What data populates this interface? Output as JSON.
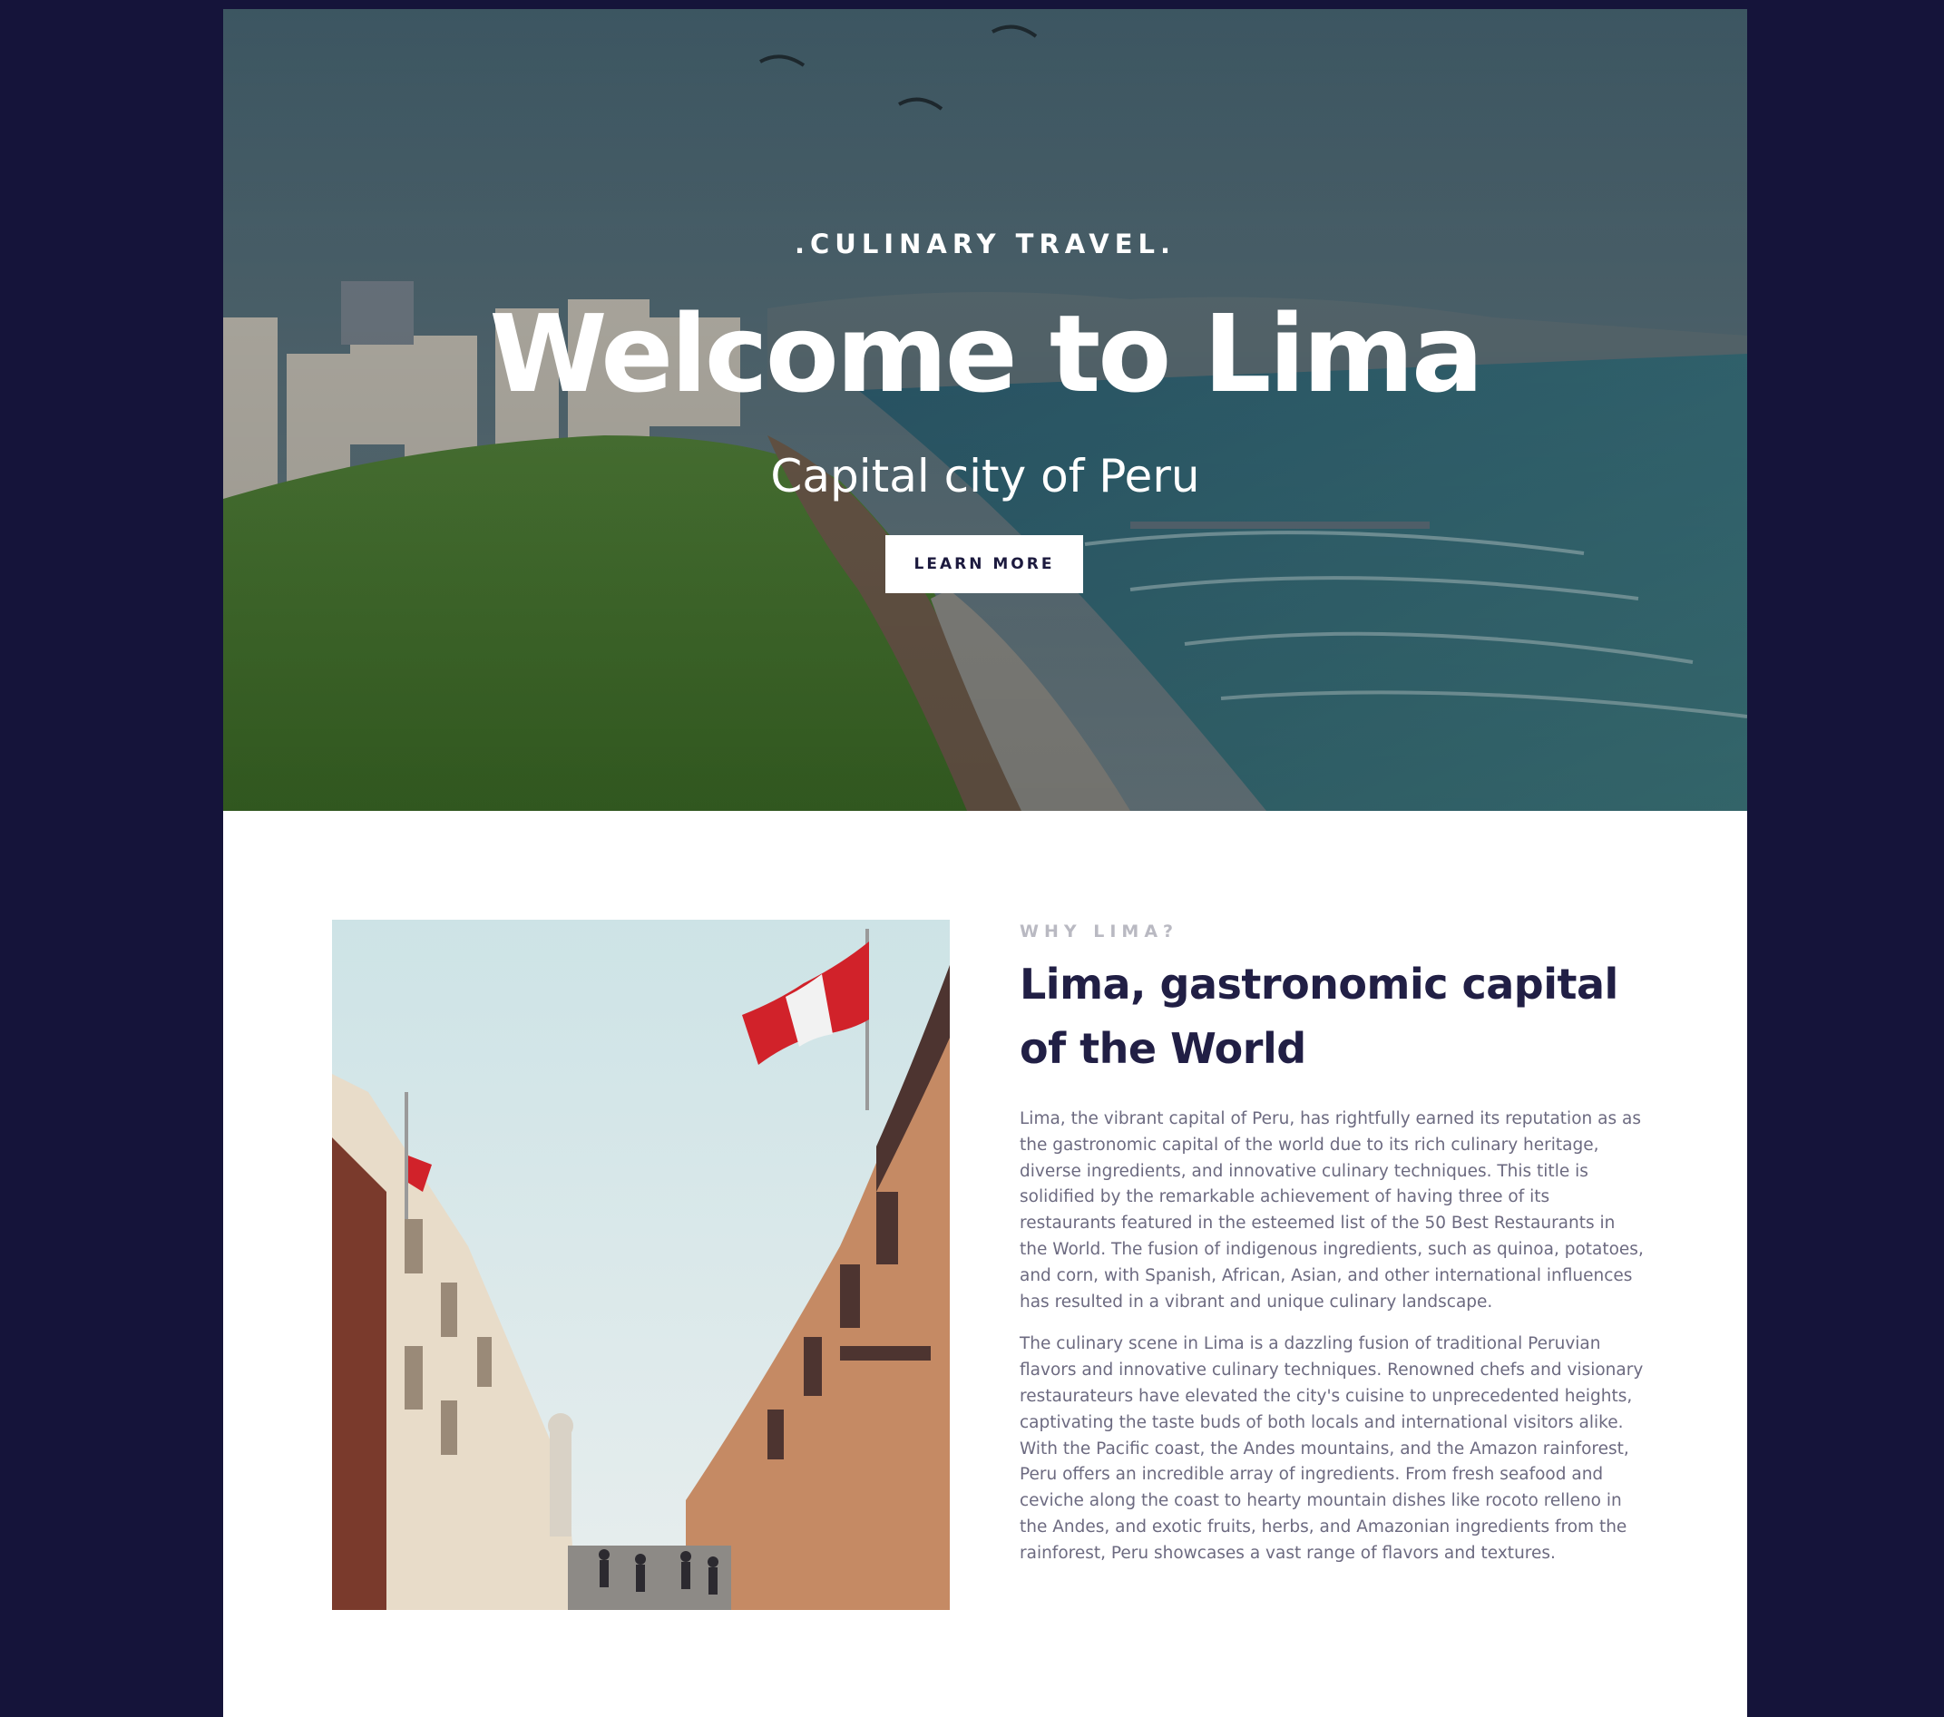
{
  "hero": {
    "eyebrow": ".CULINARY TRAVEL.",
    "title": "Welcome to Lima",
    "subtitle": "Capital city of Peru",
    "button_label": "LEARN MORE"
  },
  "about": {
    "eyebrow": "WHY LIMA?",
    "heading": "Lima, gastronomic capital of the World",
    "paragraphs": [
      "Lima, the vibrant capital of Peru, has rightfully earned its reputation as as the gastronomic capital of the world due to its rich culinary heritage, diverse ingredients, and innovative culinary techniques. This title is solidified by the remarkable achievement of having three of its restaurants featured in the esteemed list of the 50 Best Restaurants in the World. The fusion of indigenous ingredients, such as quinoa, potatoes, and corn, with Spanish, African, Asian, and other international influences has resulted in a vibrant and unique culinary landscape.",
      "The culinary scene in Lima is a dazzling fusion of traditional Peruvian flavors and innovative culinary techniques. Renowned chefs and visionary restaurateurs have elevated the city's cuisine to unprecedented heights, captivating the taste buds of both locals and international visitors alike. With the Pacific coast, the Andes mountains, and the Amazon rainforest, Peru offers an incredible array of ingredients. From fresh seafood and ceviche along the coast to hearty mountain dishes like rocoto relleno in the Andes, and exotic fruits, herbs, and Amazonian ingredients from the rainforest, Peru showcases a vast range of flavors and textures."
    ]
  },
  "colors": {
    "page_background": "#15143a",
    "heading": "#211f45",
    "body_text": "#6c6a80",
    "eyebrow": "#b9b9c2"
  }
}
